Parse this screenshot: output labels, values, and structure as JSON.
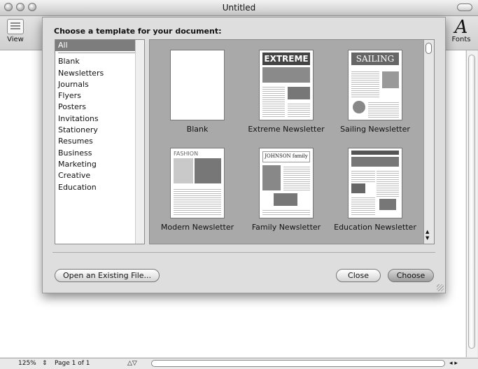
{
  "window": {
    "title": "Untitled"
  },
  "toolbar": {
    "view_label": "View",
    "fonts_label": "Fonts"
  },
  "dialog": {
    "title": "Choose a template for your document:",
    "categories": [
      "All",
      "Blank",
      "Newsletters",
      "Journals",
      "Flyers",
      "Posters",
      "Invitations",
      "Stationery",
      "Resumes",
      "Business",
      "Marketing",
      "Creative",
      "Education"
    ],
    "selected_category": "All",
    "templates": [
      {
        "label": "Blank"
      },
      {
        "label": "Extreme Newsletter",
        "masthead": "EXTREME"
      },
      {
        "label": "Sailing Newsletter",
        "masthead": "SAILING"
      },
      {
        "label": "Modern Newsletter",
        "masthead": "FASHION"
      },
      {
        "label": "Family Newsletter",
        "masthead": "JOHNSON family"
      },
      {
        "label": "Education Newsletter"
      }
    ],
    "open_existing_label": "Open an Existing File...",
    "close_label": "Close",
    "choose_label": "Choose"
  },
  "status": {
    "zoom": "125%",
    "page": "Page 1 of 1"
  }
}
